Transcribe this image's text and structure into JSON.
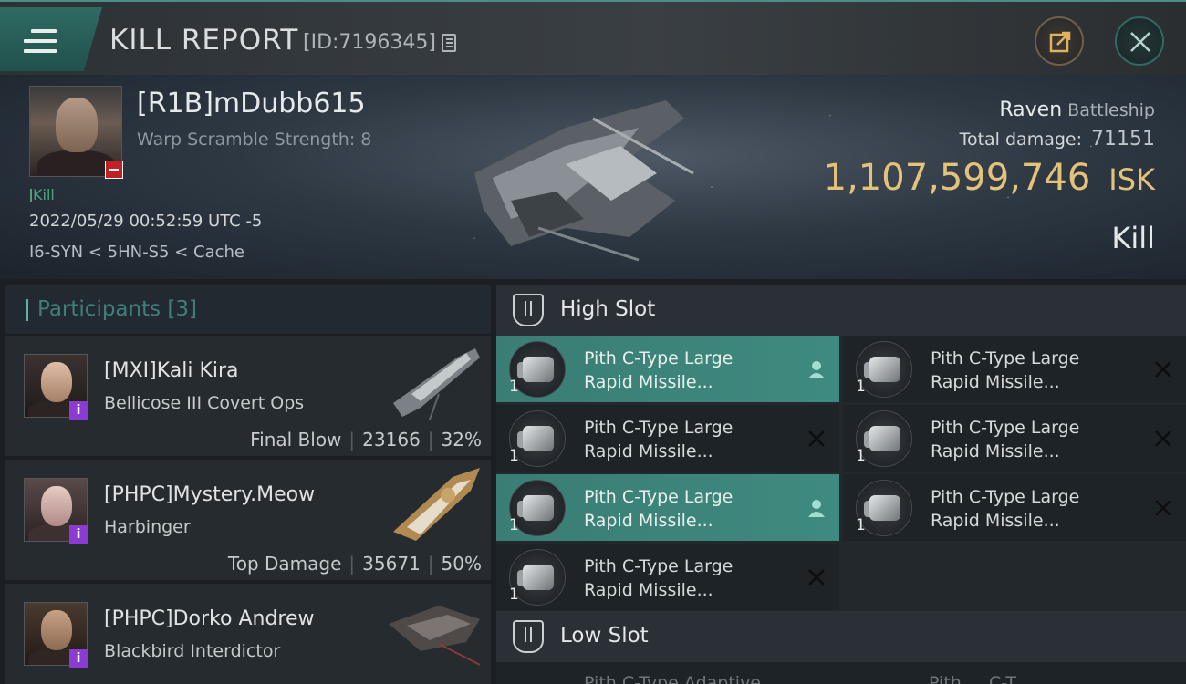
{
  "header": {
    "title": "KILL REPORT",
    "report_id": "[ID:7196345]"
  },
  "victim": {
    "name": "[R1B]mDubb615",
    "warp_scramble": "Warp Scramble Strength: 8",
    "kill_tag": "Kill",
    "datetime": "2022/05/29 00:52:59 UTC -5",
    "location": "I6-SYN < 5HN-S5 < Cache",
    "ship_name": "Raven",
    "ship_class": "Battleship",
    "total_damage_label": "Total damage:",
    "total_damage": "71151",
    "isk_value": "1,107,599,746",
    "isk_unit": "ISK",
    "result": "Kill"
  },
  "participants": {
    "title": "Participants",
    "count": "[3]",
    "items": [
      {
        "name": "[MXI]Kali Kira",
        "ship": "Bellicose III Covert Ops",
        "label": "Final Blow",
        "damage": "23166",
        "percent": "32%"
      },
      {
        "name": "[PHPC]Mystery.Meow",
        "ship": "Harbinger",
        "label": "Top Damage",
        "damage": "35671",
        "percent": "50%"
      },
      {
        "name": "[PHPC]Dorko Andrew",
        "ship": "Blackbird Interdictor",
        "label": "",
        "damage": "",
        "percent": ""
      }
    ]
  },
  "fittings": {
    "high_slot_title": "High Slot",
    "low_slot_title": "Low Slot",
    "high_modules": [
      {
        "qty": "1",
        "line1": "Pith C-Type Large",
        "line2": "Rapid Missile...",
        "status": "dropped"
      },
      {
        "qty": "1",
        "line1": "Pith C-Type Large",
        "line2": "Rapid Missile...",
        "status": "destroyed"
      },
      {
        "qty": "1",
        "line1": "Pith C-Type Large",
        "line2": "Rapid Missile...",
        "status": "destroyed"
      },
      {
        "qty": "1",
        "line1": "Pith C-Type Large",
        "line2": "Rapid Missile...",
        "status": "destroyed"
      },
      {
        "qty": "1",
        "line1": "Pith C-Type Large",
        "line2": "Rapid Missile...",
        "status": "dropped"
      },
      {
        "qty": "1",
        "line1": "Pith C-Type Large",
        "line2": "Rapid Missile...",
        "status": "destroyed"
      },
      {
        "qty": "1",
        "line1": "Pith C-Type Large",
        "line2": "Rapid Missile...",
        "status": "destroyed"
      }
    ],
    "low_peek": [
      "Pith C-Type Adaptive",
      "Pith . . C-T. . ."
    ]
  },
  "icons": {
    "menu": "hamburger-icon",
    "copy": "copy-icon",
    "share": "share-icon",
    "close": "close-icon",
    "dropped": "person-icon",
    "destroyed": "x-icon"
  },
  "colors": {
    "accent": "#3f8a80",
    "isk": "#e3c27a",
    "kill": "#4fa07a",
    "info_badge": "#8b3bd1"
  }
}
